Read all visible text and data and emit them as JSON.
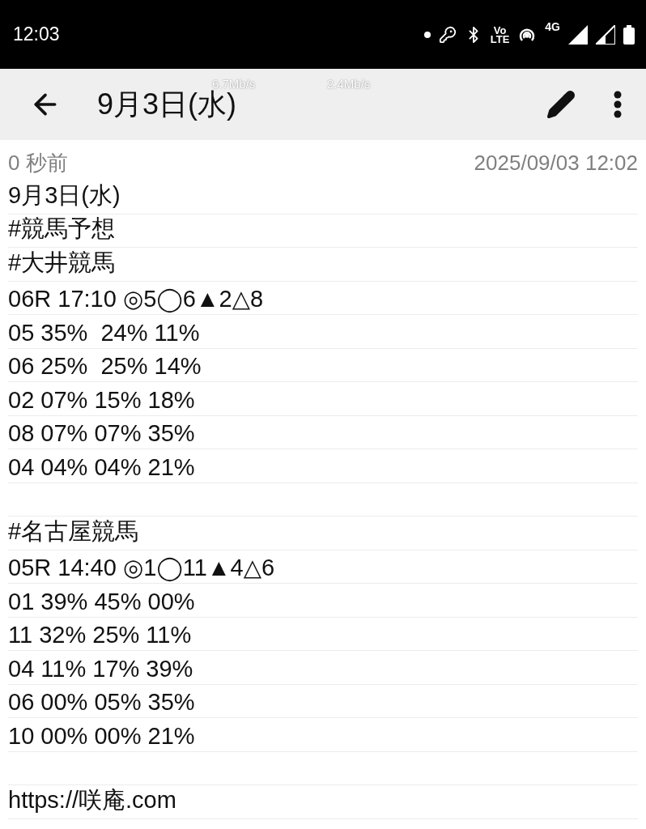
{
  "status_bar": {
    "time": "12:03",
    "volte_label": [
      "Vo",
      "LTE"
    ],
    "network_label": "4G"
  },
  "speed_overlay": [
    "6.7Mb/s",
    "2.4Mb/s"
  ],
  "app_bar": {
    "title": "9月3日(水)"
  },
  "meta": {
    "relative_time": "0 秒前",
    "timestamp": "2025/09/03 12:02"
  },
  "note_paragraphs": [
    [
      "9月3日(水)",
      "#競馬予想",
      "#大井競馬",
      "06R 17:10 ◎5◯6▲2△8",
      "05 35%  24% 11%",
      "06 25%  25% 14%",
      "02 07% 15% 18%",
      "08 07% 07% 35%",
      "04 04% 04% 21%"
    ],
    [
      "#名古屋競馬",
      "05R 14:40 ◎1◯11▲4△6",
      "01 39% 45% 00%",
      "11 32% 25% 11%",
      "04 11% 17% 39%",
      "06 00% 05% 35%",
      "10 00% 00% 21%"
    ],
    [
      "https://咲庵.com"
    ]
  ]
}
